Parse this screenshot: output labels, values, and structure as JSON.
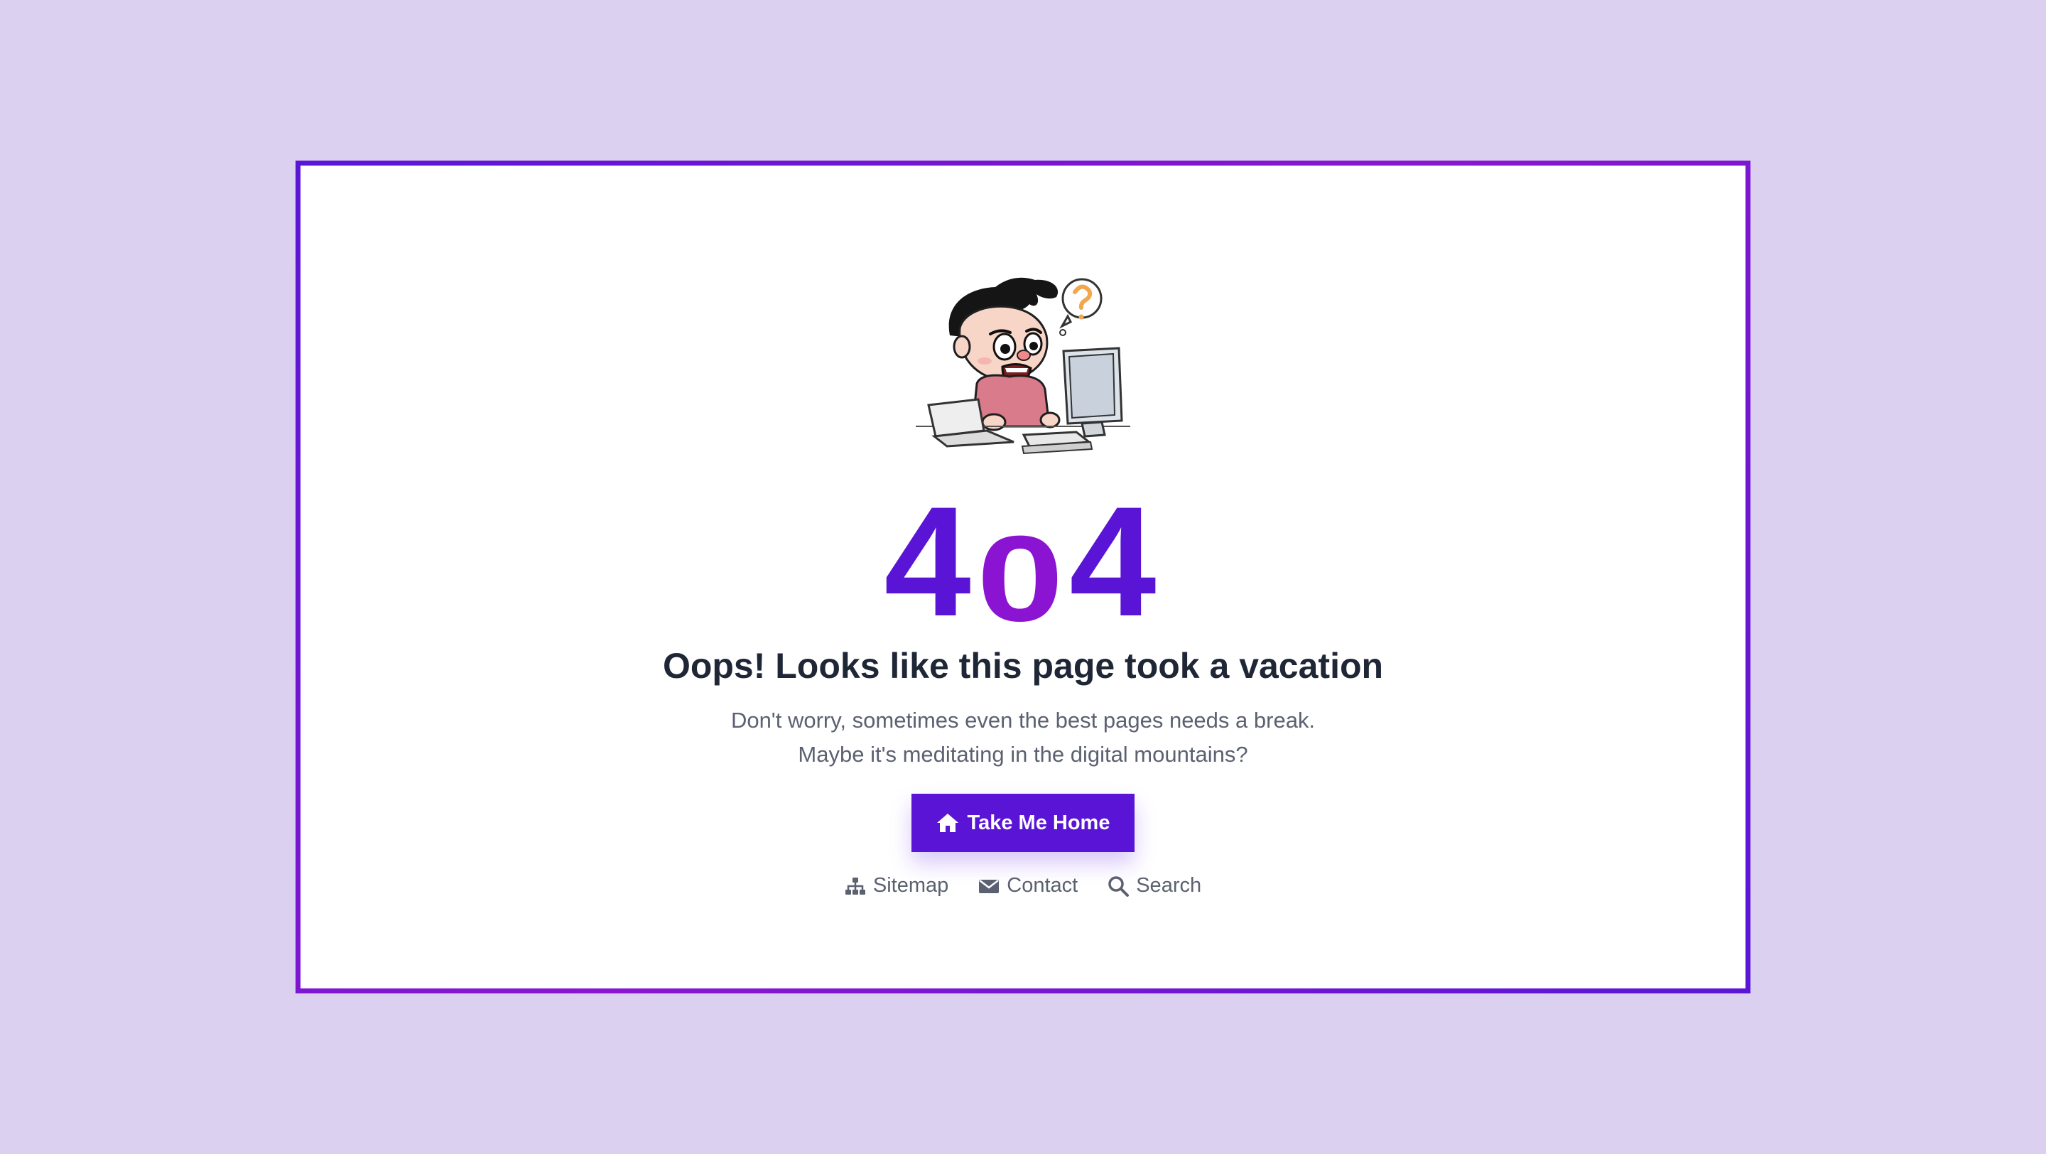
{
  "error": {
    "code_first": "4",
    "code_middle": "0",
    "code_last": "4",
    "title": "Oops! Looks like this page took a vacation",
    "subtitle_line1": "Don't worry, sometimes even the best pages needs a break.",
    "subtitle_line2": "Maybe it's meditating in the digital mountains?"
  },
  "home_button": {
    "label": "Take Me Home",
    "icon": "home-icon"
  },
  "links": [
    {
      "label": "Sitemap",
      "icon": "sitemap-icon"
    },
    {
      "label": "Contact",
      "icon": "envelope-icon"
    },
    {
      "label": "Search",
      "icon": "search-icon"
    }
  ],
  "colors": {
    "background": "#dbd0f0",
    "accent": "#5a14d6",
    "accent_alt": "#8b14d2",
    "title_text": "#1f2636",
    "muted_text": "#5b6170"
  }
}
